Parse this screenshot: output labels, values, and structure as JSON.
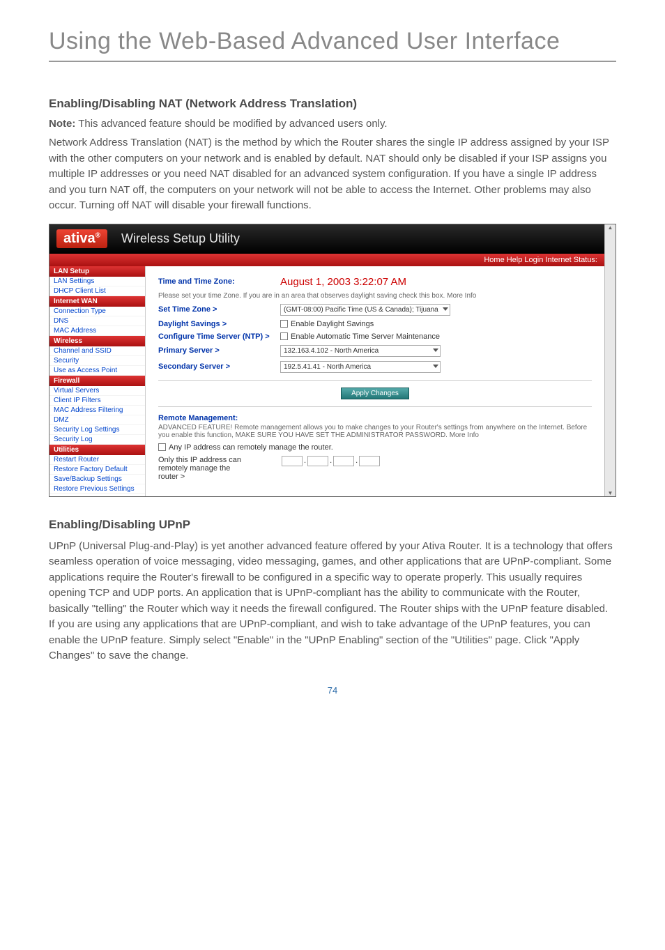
{
  "page": {
    "title": "Using the Web-Based Advanced User Interface",
    "page_number": "74"
  },
  "section1": {
    "heading": "Enabling/Disabling NAT (Network Address Translation)",
    "note_label": "Note:",
    "note_text": " This advanced feature should be modified by advanced users only.",
    "body": "Network Address Translation (NAT) is the method by which the Router shares the single IP address assigned by your ISP with the other computers on your network and is enabled by default. NAT should only be disabled if your ISP assigns you multiple IP addresses or you need NAT disabled for an advanced system configuration. If you have a single IP address and you turn NAT off, the computers on your network will not be able to access the Internet. Other problems may also occur. Turning off NAT will disable your firewall functions."
  },
  "screenshot": {
    "brand": "ativa",
    "tm": "®",
    "top_title": "Wireless Setup Utility",
    "top_links": "Home  Help  Login    Internet Status:",
    "sidebar": {
      "groups": [
        {
          "head": "LAN Setup",
          "items": [
            "LAN Settings",
            "DHCP Client List"
          ]
        },
        {
          "head": "Internet WAN",
          "items": [
            "Connection Type",
            "DNS",
            "MAC Address"
          ]
        },
        {
          "head": "Wireless",
          "items": [
            "Channel and SSID",
            "Security",
            "Use as Access Point"
          ]
        },
        {
          "head": "Firewall",
          "items": [
            "Virtual Servers",
            "Client IP Filters",
            "MAC Address Filtering",
            "DMZ",
            "Security Log Settings",
            "Security Log"
          ]
        },
        {
          "head": "Utilities",
          "items": [
            "Restart Router",
            "Restore Factory Default",
            "Save/Backup Settings",
            "Restore Previous Settings"
          ]
        }
      ]
    },
    "main": {
      "tz_link": "Time and Time Zone:",
      "tz_value": "August 1, 2003  3:22:07 AM",
      "tz_desc": "Please set your time Zone. If you are in an area that observes daylight saving check this box. More Info",
      "row1_label": "Set Time Zone >",
      "row1_value": "(GMT-08:00) Pacific Time (US & Canada); Tijuana",
      "row2_label": "Daylight Savings >",
      "row2_value": "Enable Daylight Savings",
      "row3_label": "Configure Time Server (NTP) >",
      "row3_value": "Enable Automatic Time Server Maintenance",
      "row4_label": "Primary Server >",
      "row4_value": "132.163.4.102 - North America",
      "row5_label": "Secondary Server >",
      "row5_value": "192.5.41.41 - North America",
      "apply_btn": "Apply Changes",
      "remote_head": "Remote Management:",
      "remote_desc": "ADVANCED FEATURE! Remote management allows you to make changes to your Router's settings from anywhere on the Internet. Before you enable this function, MAKE SURE YOU HAVE SET THE ADMINISTRATOR PASSWORD. More Info",
      "remote_cb1": "Any IP address can remotely manage the router.",
      "remote_cb2_a": "Only this IP address can",
      "remote_cb2_b": "remotely manage the",
      "remote_cb2_c": "router >"
    }
  },
  "section2": {
    "heading": "Enabling/Disabling UPnP",
    "body": "UPnP (Universal Plug-and-Play) is yet another advanced feature offered by your Ativa Router. It is a technology that offers seamless operation of voice messaging, video messaging, games, and other applications that are UPnP-compliant. Some applications require the Router's firewall to be configured in a specific way to operate properly. This usually requires opening TCP and UDP ports. An application that is UPnP-compliant has the ability to communicate with the Router, basically \"telling\" the Router which way it needs the firewall configured. The Router ships with the UPnP feature disabled. If you are using any applications that are UPnP-compliant, and wish to take advantage of the UPnP features, you can enable the UPnP feature. Simply select \"Enable\" in the \"UPnP Enabling\" section of the \"Utilities\" page. Click \"Apply Changes\" to save the change."
  }
}
